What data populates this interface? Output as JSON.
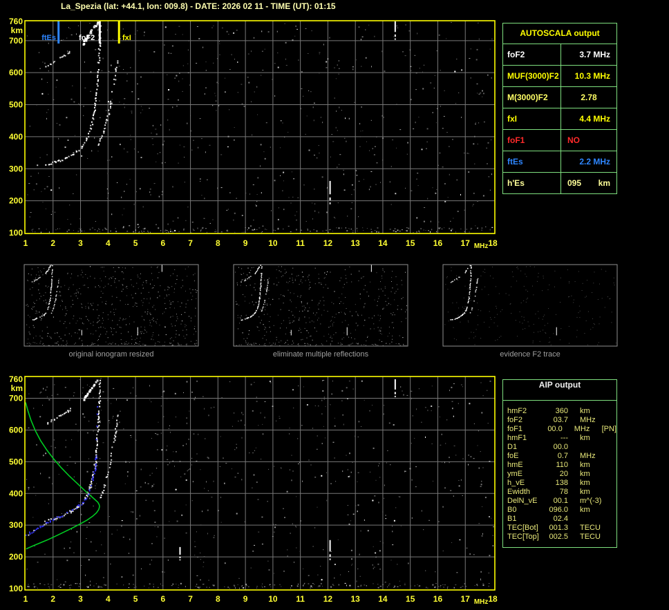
{
  "header": {
    "title": "La_Spezia (lat: +44.1, lon: 009.8) - DATE: 2026 02 11 - TIME (UT): 01:15"
  },
  "colors": {
    "axis_yellow": "#FFFF33",
    "border_yellow": "#FFFF00",
    "table_green": "#7FE07F",
    "grid_gray": "#787878",
    "caption_gray": "#A0A0A0",
    "profile_green": "#00CC22",
    "model_blue": "#3232EE",
    "marker_blue": "#2E86FF",
    "alert_red": "#FF2A2A",
    "pale_yellow": "#FFFF99",
    "title_yellow": "#FFFFB0"
  },
  "autoscala": {
    "title": "AUTOSCALA output",
    "title_color": "#FFFF00",
    "rows": [
      {
        "label": "foF2",
        "value": "3.7 MHz",
        "color": "#FFFFFF",
        "align": "right"
      },
      {
        "label": "MUF(3000)F2",
        "value": "10.3 MHz",
        "color": "#FFFF00",
        "align": "right"
      },
      {
        "label": "M(3000)F2",
        "value": "2.78",
        "color": "#FFFF66",
        "align": "center"
      },
      {
        "label": "fxI",
        "value": "4.4 MHz",
        "color": "#FFFF00",
        "align": "right"
      },
      {
        "label": "foF1",
        "value": "NO",
        "color": "#FF2A2A",
        "align": "left"
      },
      {
        "label": "ftEs",
        "value": "2.2 MHz",
        "color": "#2E86FF",
        "align": "right"
      },
      {
        "label": "h'Es",
        "value": "095",
        "unit": "km",
        "color": "#FFFF99",
        "align": "split"
      }
    ]
  },
  "aip": {
    "title": "AIP output",
    "title_color": "#F0F0F0",
    "row_color": "#E8E87A",
    "rows": [
      {
        "label": "hmF2",
        "value": "360",
        "unit": "km",
        "extra": ""
      },
      {
        "label": "foF2",
        "value": "03.7",
        "unit": "MHz",
        "extra": ""
      },
      {
        "label": "foF1",
        "value": "00.0",
        "unit": "MHz",
        "extra": "[PN]"
      },
      {
        "label": "hmF1",
        "value": "---",
        "unit": "km",
        "extra": ""
      },
      {
        "label": "D1",
        "value": "00.0",
        "unit": "",
        "extra": ""
      },
      {
        "label": "foE",
        "value": "0.7",
        "unit": "MHz",
        "extra": ""
      },
      {
        "label": "hmE",
        "value": "110",
        "unit": "km",
        "extra": ""
      },
      {
        "label": "ymE",
        "value": "20",
        "unit": "km",
        "extra": ""
      },
      {
        "label": "h_vE",
        "value": "138",
        "unit": "km",
        "extra": ""
      },
      {
        "label": "Ewidth",
        "value": "78",
        "unit": "km",
        "extra": ""
      },
      {
        "label": "DelN_vE",
        "value": "00.1",
        "unit": "m^(-3)",
        "extra": ""
      },
      {
        "label": "B0",
        "value": "096.0",
        "unit": "km",
        "extra": ""
      },
      {
        "label": "B1",
        "value": "02.4",
        "unit": "",
        "extra": ""
      },
      {
        "label": "TEC[Bot]",
        "value": "001.3",
        "unit": "TECU",
        "extra": ""
      },
      {
        "label": "TEC[Top]",
        "value": "002.5",
        "unit": "TECU",
        "extra": ""
      }
    ]
  },
  "thumbnails": [
    {
      "caption": "original ionogram resized"
    },
    {
      "caption": "eliminate multiple reflections"
    },
    {
      "caption": "evidence F2 trace"
    }
  ],
  "chart_data": [
    {
      "name": "scaled_ionogram",
      "type": "scatter",
      "xlabel": "MHz",
      "ylabel": "km",
      "x_range": [
        1,
        18
      ],
      "y_range": [
        100,
        760
      ],
      "x_ticks": [
        "1",
        "2",
        "3",
        "4",
        "5",
        "6",
        "7",
        "8",
        "9",
        "10",
        "11",
        "12",
        "13",
        "14",
        "15",
        "16",
        "17",
        "18"
      ],
      "x_unit": "MHz",
      "y_ticks": [
        "760",
        "700",
        "600",
        "500",
        "400",
        "300",
        "200",
        "100"
      ],
      "y_unit": "km",
      "grid": true,
      "markers": [
        {
          "label": "ftEs",
          "f": 2.2,
          "color": "#2E86FF"
        },
        {
          "label": "foF2",
          "f": 3.7,
          "color": "#FFFFFF"
        },
        {
          "label": "fxI",
          "f": 4.4,
          "color": "#FFFF00"
        }
      ],
      "traces": {
        "o_trace": [
          [
            1.7,
            316
          ],
          [
            1.9,
            319
          ],
          [
            2.1,
            324
          ],
          [
            2.35,
            331
          ],
          [
            2.6,
            341
          ],
          [
            2.85,
            355
          ],
          [
            3.05,
            372
          ],
          [
            3.2,
            394
          ],
          [
            3.32,
            420
          ],
          [
            3.42,
            452
          ],
          [
            3.5,
            492
          ],
          [
            3.55,
            535
          ],
          [
            3.6,
            585
          ],
          [
            3.64,
            635
          ],
          [
            3.67,
            690
          ],
          [
            3.69,
            756
          ]
        ],
        "x_trace": [
          [
            3.62,
            372
          ],
          [
            3.7,
            390
          ],
          [
            3.8,
            412
          ],
          [
            3.9,
            440
          ],
          [
            4.0,
            472
          ],
          [
            4.08,
            508
          ],
          [
            4.15,
            545
          ],
          [
            4.22,
            580
          ],
          [
            4.28,
            615
          ],
          [
            4.33,
            650
          ]
        ],
        "second_hop_cusp": [
          [
            1.72,
            622
          ],
          [
            1.9,
            630
          ],
          [
            2.1,
            639
          ],
          [
            2.3,
            649
          ],
          [
            2.5,
            660
          ],
          [
            2.62,
            668
          ]
        ],
        "second_hop_asymptote": [
          [
            3.05,
            692
          ],
          [
            3.18,
            708
          ],
          [
            3.32,
            726
          ],
          [
            3.46,
            744
          ],
          [
            3.58,
            758
          ]
        ]
      },
      "es_band_km": [
        100,
        116
      ],
      "interference_lines": [
        {
          "f": 12.08,
          "km": [
            186,
            262
          ]
        },
        {
          "f": 14.45,
          "km": [
            700,
            760
          ]
        }
      ]
    },
    {
      "name": "ionogram_with_profile",
      "type": "scatter",
      "xlabel": "MHz",
      "ylabel": "km",
      "x_range": [
        1,
        18
      ],
      "y_range": [
        100,
        760
      ],
      "x_ticks": [
        "1",
        "2",
        "3",
        "4",
        "5",
        "6",
        "7",
        "8",
        "9",
        "10",
        "11",
        "12",
        "13",
        "14",
        "15",
        "16",
        "17",
        "18"
      ],
      "x_unit": "MHz",
      "y_ticks": [
        "760",
        "700",
        "600",
        "500",
        "400",
        "300",
        "200",
        "100"
      ],
      "y_unit": "km",
      "grid": true,
      "markers": [],
      "traces": {
        "o_trace": [
          [
            1.7,
            316
          ],
          [
            1.9,
            319
          ],
          [
            2.1,
            324
          ],
          [
            2.35,
            331
          ],
          [
            2.6,
            341
          ],
          [
            2.85,
            355
          ],
          [
            3.05,
            372
          ],
          [
            3.2,
            394
          ],
          [
            3.32,
            420
          ],
          [
            3.42,
            452
          ],
          [
            3.5,
            492
          ],
          [
            3.55,
            535
          ],
          [
            3.6,
            585
          ],
          [
            3.64,
            635
          ],
          [
            3.67,
            690
          ],
          [
            3.69,
            756
          ]
        ],
        "x_trace": [
          [
            3.62,
            372
          ],
          [
            3.7,
            390
          ],
          [
            3.8,
            412
          ],
          [
            3.9,
            440
          ],
          [
            4.0,
            472
          ],
          [
            4.08,
            508
          ],
          [
            4.15,
            545
          ],
          [
            4.22,
            580
          ],
          [
            4.28,
            615
          ],
          [
            4.33,
            650
          ]
        ],
        "second_hop_cusp": [
          [
            1.72,
            622
          ],
          [
            1.9,
            630
          ],
          [
            2.1,
            639
          ],
          [
            2.3,
            649
          ],
          [
            2.5,
            660
          ],
          [
            2.62,
            668
          ]
        ],
        "second_hop_asymptote": [
          [
            3.05,
            692
          ],
          [
            3.18,
            708
          ],
          [
            3.32,
            726
          ],
          [
            3.46,
            744
          ],
          [
            3.58,
            758
          ]
        ]
      },
      "model_trace_blue": [
        [
          1.02,
          268
        ],
        [
          1.25,
          283
        ],
        [
          1.5,
          296
        ],
        [
          1.75,
          308
        ],
        [
          2.0,
          319
        ],
        [
          2.25,
          330
        ],
        [
          2.5,
          341
        ],
        [
          2.72,
          351
        ],
        [
          2.95,
          364
        ],
        [
          3.12,
          380
        ],
        [
          3.26,
          400
        ],
        [
          3.37,
          424
        ],
        [
          3.45,
          452
        ],
        [
          3.51,
          482
        ],
        [
          3.55,
          512
        ],
        [
          3.57,
          540
        ]
      ],
      "model_trace_blue_dots": [
        [
          3.58,
          570
        ],
        [
          3.6,
          612
        ],
        [
          3.61,
          650
        ],
        [
          3.62,
          673
        ]
      ],
      "density_profile_green": [
        [
          1.0,
          687
        ],
        [
          1.08,
          662
        ],
        [
          1.2,
          630
        ],
        [
          1.36,
          597
        ],
        [
          1.55,
          566
        ],
        [
          1.78,
          536
        ],
        [
          2.03,
          508
        ],
        [
          2.3,
          481
        ],
        [
          2.58,
          456
        ],
        [
          2.86,
          433
        ],
        [
          3.12,
          412
        ],
        [
          3.34,
          395
        ],
        [
          3.52,
          381
        ],
        [
          3.63,
          372
        ],
        [
          3.68,
          364
        ],
        [
          3.69,
          358
        ],
        [
          3.66,
          349
        ],
        [
          3.58,
          339
        ],
        [
          3.44,
          328
        ],
        [
          3.24,
          316
        ],
        [
          2.99,
          304
        ],
        [
          2.7,
          291
        ],
        [
          2.39,
          278
        ],
        [
          2.08,
          265
        ],
        [
          1.78,
          253
        ],
        [
          1.5,
          243
        ],
        [
          1.28,
          235
        ],
        [
          1.12,
          229
        ],
        [
          1.02,
          225
        ]
      ],
      "profile_peak": {
        "hmF2_km": 360,
        "foF2_MHz": 3.7
      },
      "es_band_km": [
        100,
        116
      ],
      "interference_lines": [
        {
          "f": 6.62,
          "km": [
            187,
            231
          ]
        },
        {
          "f": 12.08,
          "km": [
            187,
            253
          ]
        },
        {
          "f": 14.45,
          "km": [
            701,
            760
          ]
        }
      ]
    }
  ]
}
